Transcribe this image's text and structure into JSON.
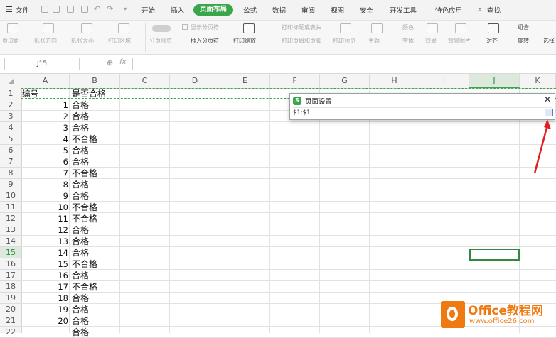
{
  "menubar": {
    "file_label": "文件",
    "tabs": [
      "开始",
      "插入",
      "页面布局",
      "公式",
      "数据",
      "审阅",
      "视图",
      "安全",
      "开发工具",
      "特色应用"
    ],
    "active_tab": "页面布局",
    "search_label": "查找"
  },
  "ribbon": {
    "margins": "页边距",
    "orientation": "纸张方向",
    "size": "纸张大小",
    "print_area": "打印区域",
    "page_break_preview": "分页预览",
    "show_page_breaks": "显示分页符",
    "insert_page_break": "插入分页符",
    "print_scaling": "打印缩放",
    "print_titles": "打印标题或表头",
    "print_header_footer": "打印页眉和页脚",
    "print_preview": "打印预览",
    "theme": "主题",
    "colors": "颜色",
    "fonts": "字体",
    "effects": "效果",
    "background": "背景图片",
    "align": "对齐",
    "group": "组合",
    "rotate": "旋转",
    "select": "选择"
  },
  "formula_bar": {
    "name_box": "J15",
    "fx_label": "fx",
    "formula": ""
  },
  "grid": {
    "columns": [
      "A",
      "B",
      "C",
      "D",
      "E",
      "F",
      "G",
      "H",
      "I",
      "J",
      "K"
    ],
    "selected_column": "J",
    "row_numbers": [
      "1",
      "2",
      "3",
      "4",
      "5",
      "6",
      "7",
      "8",
      "9",
      "10",
      "11",
      "12",
      "13",
      "14",
      "15",
      "16",
      "17",
      "18",
      "19",
      "20",
      "21",
      "22"
    ],
    "selected_row": "15",
    "rows": [
      {
        "a": "编号",
        "b": "是否合格",
        "header": true
      },
      {
        "a": "1",
        "b": "合格"
      },
      {
        "a": "2",
        "b": "合格"
      },
      {
        "a": "3",
        "b": "合格"
      },
      {
        "a": "4",
        "b": "不合格"
      },
      {
        "a": "5",
        "b": "合格"
      },
      {
        "a": "6",
        "b": "合格"
      },
      {
        "a": "7",
        "b": "不合格"
      },
      {
        "a": "8",
        "b": "合格"
      },
      {
        "a": "9",
        "b": "合格"
      },
      {
        "a": "10",
        "b": "不合格"
      },
      {
        "a": "11",
        "b": "不合格"
      },
      {
        "a": "12",
        "b": "合格"
      },
      {
        "a": "13",
        "b": "合格"
      },
      {
        "a": "14",
        "b": "合格"
      },
      {
        "a": "15",
        "b": "不合格"
      },
      {
        "a": "16",
        "b": "合格"
      },
      {
        "a": "17",
        "b": "不合格"
      },
      {
        "a": "18",
        "b": "合格"
      },
      {
        "a": "19",
        "b": "合格"
      },
      {
        "a": "20",
        "b": "合格"
      },
      {
        "a": "",
        "b": "合格"
      }
    ]
  },
  "dialog": {
    "title": "页面设置",
    "value": "$1:$1"
  },
  "watermark": {
    "brand": "Office教程网",
    "url": "www.office26.com"
  },
  "colors": {
    "accent": "#3aa64b",
    "arrow": "#e02020",
    "watermark_orange": "#f07a12"
  }
}
